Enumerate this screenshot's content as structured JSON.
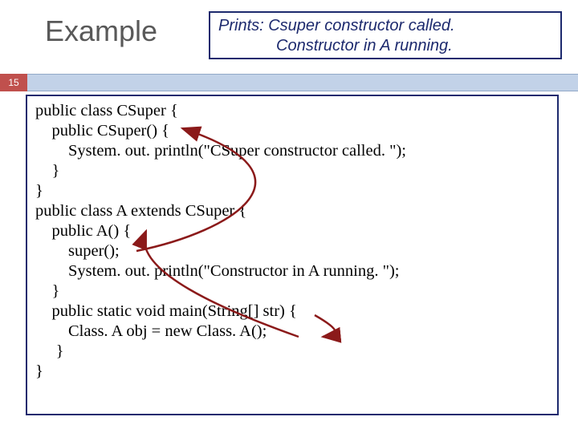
{
  "title": "Example",
  "caption": {
    "line1": "Prints:  Csuper constructor  called.",
    "line2": "Constructor in A running."
  },
  "page_number": "15",
  "code": {
    "l1": "public class CSuper {",
    "l2": "    public CSuper() {",
    "l3": "        System. out. println(\"CSuper constructor called. \");",
    "l4": "    }",
    "l5": "}",
    "l6": "public class A extends CSuper {",
    "l7": "    public A() {",
    "l8": "        super();",
    "l9": "        System. out. println(\"Constructor in A running. \");",
    "l10": "    }",
    "l11": "    public static void main(String[] str) {",
    "l12": "        Class. A obj = new Class. A();",
    "l13": "     }",
    "l14": "}"
  }
}
